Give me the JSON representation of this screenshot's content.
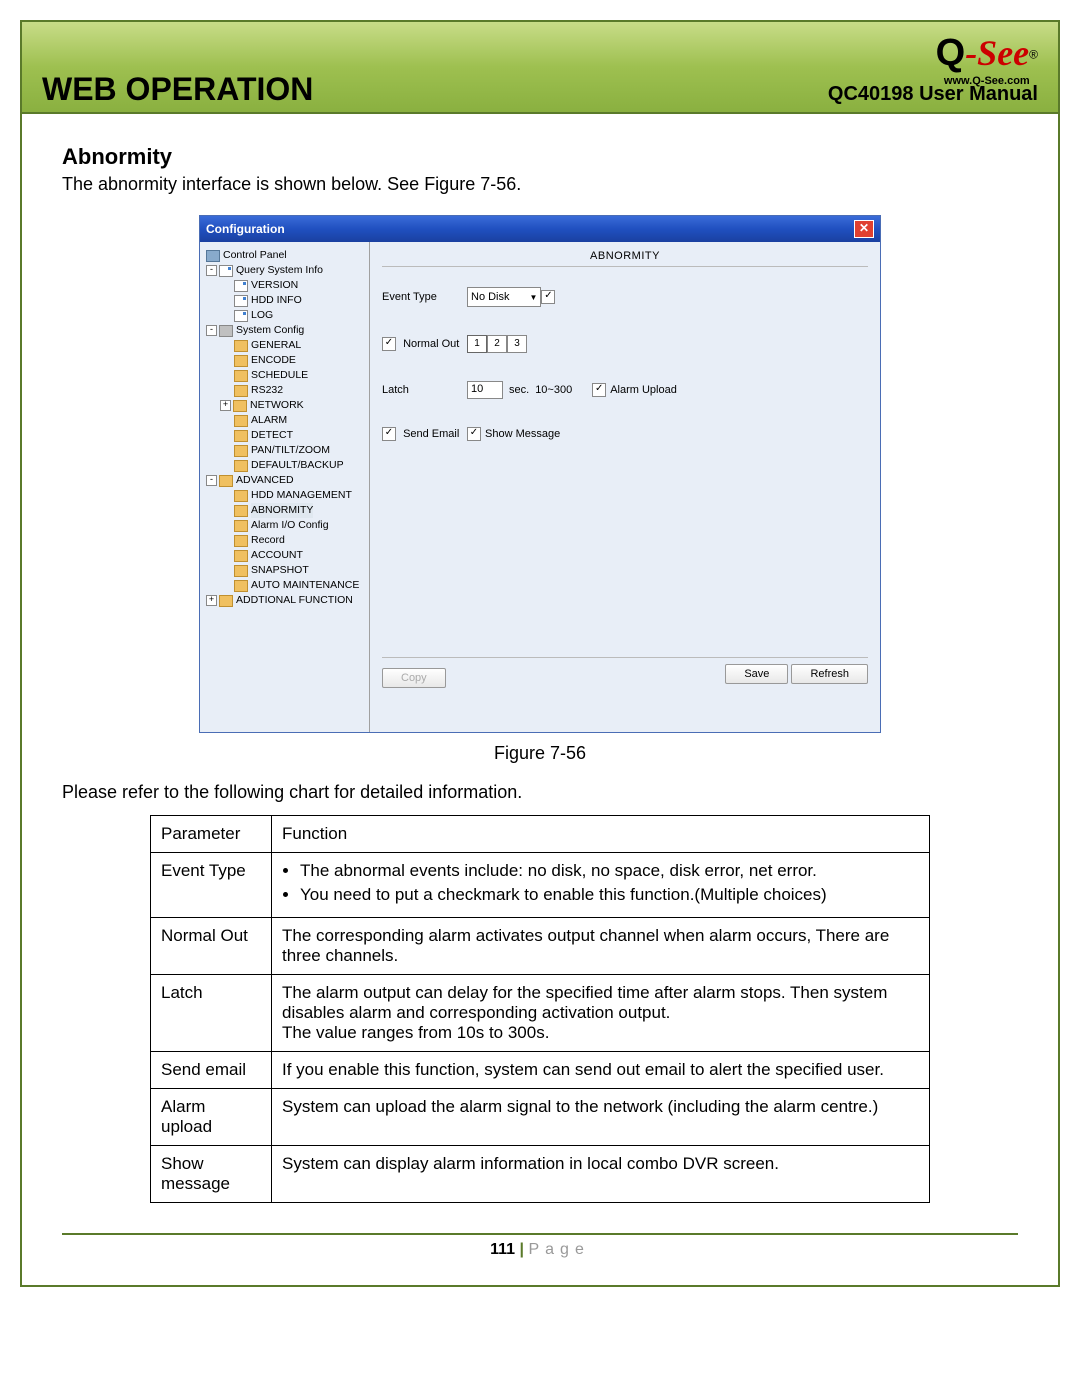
{
  "header": {
    "web_operation": "WEB OPERATION",
    "manual": "QC40198 User Manual",
    "logo_text": "-See",
    "logo_url": "www.Q-See.com"
  },
  "section": {
    "title": "Abnormity",
    "intro": "The abnormity interface is shown below. See Figure 7-56."
  },
  "config": {
    "title": "Configuration",
    "close": "✕",
    "tree": {
      "control_panel": "Control Panel",
      "query": "Query System Info",
      "version": "VERSION",
      "hdd_info": "HDD INFO",
      "log": "LOG",
      "system_config": "System Config",
      "general": "GENERAL",
      "encode": "ENCODE",
      "schedule": "SCHEDULE",
      "rs232": "RS232",
      "network": "NETWORK",
      "alarm": "ALARM",
      "detect": "DETECT",
      "ptz": "PAN/TILT/ZOOM",
      "default_backup": "DEFAULT/BACKUP",
      "advanced": "ADVANCED",
      "hdd_mgmt": "HDD MANAGEMENT",
      "abnormity": "ABNORMITY",
      "alarm_io": "Alarm I/O Config",
      "record": "Record",
      "account": "ACCOUNT",
      "snapshot": "SNAPSHOT",
      "auto_maint": "AUTO MAINTENANCE",
      "addl_func": "ADDTIONAL FUNCTION"
    },
    "pane": {
      "title": "ABNORMITY",
      "event_type_label": "Event Type",
      "event_type_value": "No Disk",
      "normal_out_label": "Normal Out",
      "out_buttons": [
        "1",
        "2",
        "3"
      ],
      "latch_label": "Latch",
      "latch_value": "10",
      "latch_unit": "sec.",
      "latch_range": "10~300",
      "alarm_upload_label": "Alarm Upload",
      "send_email_label": "Send Email",
      "show_message_label": "Show Message",
      "copy_btn": "Copy",
      "save_btn": "Save",
      "refresh_btn": "Refresh"
    }
  },
  "figure_caption": "Figure 7-56",
  "chart_intro": "Please refer to the following chart for detailed information.",
  "chart_data": {
    "type": "table",
    "headers": [
      "Parameter",
      "Function"
    ],
    "rows": [
      {
        "param": "Event Type",
        "func_bullets": [
          "The abnormal events include: no disk, no space, disk error, net error.",
          "You need to put a checkmark to enable this function.(Multiple choices)"
        ]
      },
      {
        "param": "Normal Out",
        "func": "The corresponding alarm activates output channel when alarm occurs, There are three channels."
      },
      {
        "param": "Latch",
        "func": "The alarm output can delay for the specified time after alarm stops. Then system disables alarm and corresponding activation output.\nThe value ranges from 10s to 300s."
      },
      {
        "param": "Send email",
        "func": "If you enable this function, system can send out email to alert the specified user."
      },
      {
        "param": "Alarm upload",
        "func": "System can upload the alarm signal to the network (including the alarm centre.)"
      },
      {
        "param": "Show message",
        "func": "System can display alarm information in local combo DVR screen."
      }
    ]
  },
  "footer": {
    "page_number": "111",
    "sep": "|",
    "label": "Page"
  }
}
